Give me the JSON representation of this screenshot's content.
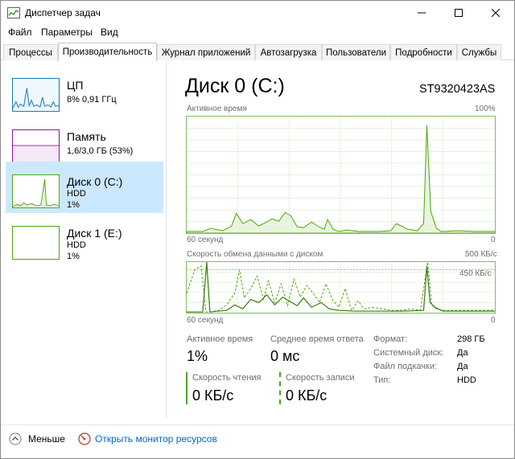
{
  "window": {
    "title": "Диспетчер задач"
  },
  "menu": [
    "Файл",
    "Параметры",
    "Вид"
  ],
  "tabs": [
    {
      "label": "Процессы",
      "active": false
    },
    {
      "label": "Производительность",
      "active": true
    },
    {
      "label": "Журнал приложений",
      "active": false
    },
    {
      "label": "Автозагрузка",
      "active": false
    },
    {
      "label": "Пользователи",
      "active": false
    },
    {
      "label": "Подробности",
      "active": false
    },
    {
      "label": "Службы",
      "active": false
    }
  ],
  "sidebar": {
    "items": [
      {
        "title": "ЦП",
        "sub1": "8% 0,91 ГГц",
        "sub2": "",
        "color": "#117dbb"
      },
      {
        "title": "Память",
        "sub1": "1,6/3,0 ГБ (53%)",
        "sub2": "",
        "color": "#8b12ae"
      },
      {
        "title": "Диск 0 (C:)",
        "sub1": "HDD",
        "sub2": "1%",
        "color": "#4da60c",
        "selected": true
      },
      {
        "title": "Диск 1 (E:)",
        "sub1": "HDD",
        "sub2": "1%",
        "color": "#4da60c"
      }
    ]
  },
  "main": {
    "title": "Диск 0 (C:)",
    "model": "ST9320423AS",
    "active_time_chart": {
      "label": "Активное время",
      "max_label": "100%",
      "time_label": "60 секунд",
      "zero_label": "0"
    },
    "transfer_chart": {
      "label": "Скорость обмена данными с диском",
      "max_label": "500 КБ/с",
      "inner_label": "450 КБ/с",
      "time_label": "60 секунд",
      "zero_label": "0"
    },
    "stats": {
      "active_time_label": "Активное время",
      "active_time_value": "1%",
      "response_label": "Среднее время ответа",
      "response_value": "0 мс",
      "read_label": "Скорость чтения",
      "read_value": "0 КБ/с",
      "write_label": "Скорость записи",
      "write_value": "0 КБ/с"
    },
    "properties": [
      {
        "label": "Формат:",
        "value": "298 ГБ"
      },
      {
        "label": "Системный диск:",
        "value": "Да"
      },
      {
        "label": "Файл подкачки:",
        "value": "Да"
      },
      {
        "label": "Тип:",
        "value": "HDD"
      }
    ]
  },
  "footer": {
    "less_label": "Меньше",
    "monitor_link": "Открыть монитор ресурсов"
  },
  "colors": {
    "disk_green": "#4da60c",
    "chart_border": "#7fbf5c",
    "grid": "#e5f1dc",
    "selected_bg": "#cce8ff",
    "link": "#0066cc"
  }
}
